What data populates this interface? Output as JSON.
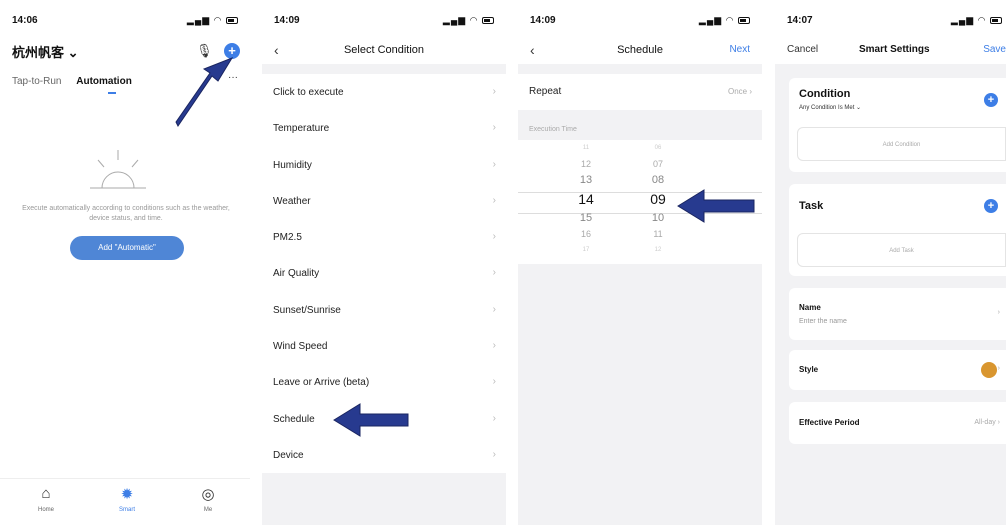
{
  "colors": {
    "accent": "#3d7ee6",
    "arrow": "#273a8f",
    "style_dot": "#d9962f"
  },
  "panel1": {
    "time": "14:06",
    "home_title": "杭州帆客 ⌄",
    "tabs": [
      "Tap-to-Run",
      "Automation"
    ],
    "more": "···",
    "empty_text": "Execute automatically according to conditions such as the weather, device status, and time.",
    "add_button": "Add \"Automatic\"",
    "tabbar": [
      {
        "label": "Home",
        "icon": "home-icon"
      },
      {
        "label": "Smart",
        "icon": "sun-icon"
      },
      {
        "label": "Me",
        "icon": "profile-icon"
      }
    ]
  },
  "panel2": {
    "time": "14:09",
    "title": "Select Condition",
    "items": [
      "Click to execute",
      "Temperature",
      "Humidity",
      "Weather",
      "PM2.5",
      "Air Quality",
      "Sunset/Sunrise",
      "Wind Speed",
      "Leave or Arrive (beta)",
      "Schedule",
      "Device"
    ]
  },
  "panel3": {
    "time": "14:09",
    "title": "Schedule",
    "next": "Next",
    "repeat_label": "Repeat",
    "repeat_value": "Once",
    "exec_label": "Execution Time",
    "hours": [
      "11",
      "12",
      "13",
      "14",
      "15",
      "16",
      "17"
    ],
    "minutes": [
      "06",
      "07",
      "08",
      "09",
      "10",
      "11",
      "12"
    ],
    "selected_hour": "14",
    "selected_minute": "09"
  },
  "panel4": {
    "time": "14:07",
    "cancel": "Cancel",
    "title": "Smart Settings",
    "save": "Save",
    "condition_title": "Condition",
    "condition_sub": "Any Condition Is Met ⌄",
    "add_condition": "Add Condition",
    "task_title": "Task",
    "add_task": "Add Task",
    "name_label": "Name",
    "name_placeholder": "Enter the name",
    "style_label": "Style",
    "period_label": "Effective Period",
    "period_value": "All-day"
  }
}
